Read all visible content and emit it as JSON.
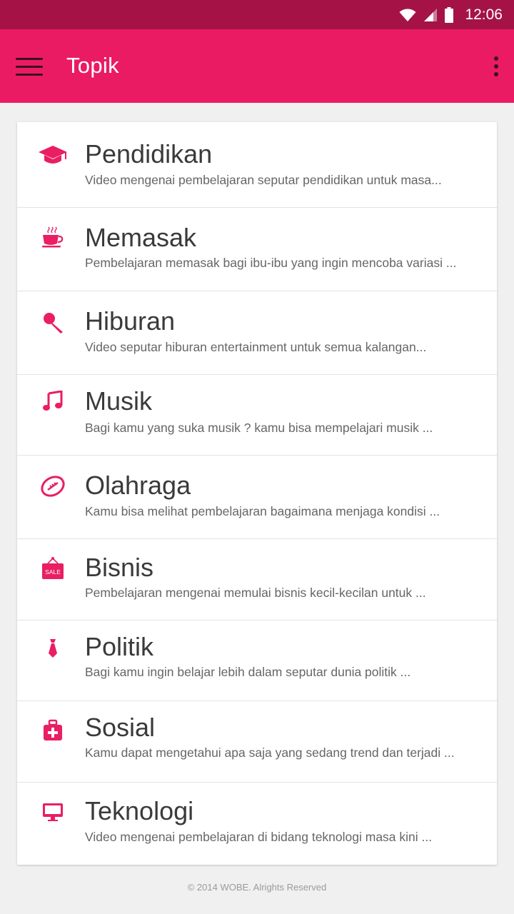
{
  "status": {
    "time": "12:06"
  },
  "appbar": {
    "title": "Topik"
  },
  "topics": [
    {
      "name": "Pendidikan",
      "desc": "Video mengenai pembelajaran seputar pendidikan untuk masa...",
      "icon": "graduation-cap-icon"
    },
    {
      "name": "Memasak",
      "desc": "Pembelajaran memasak bagi ibu-ibu yang ingin mencoba variasi ...",
      "icon": "coffee-cup-icon"
    },
    {
      "name": "Hiburan",
      "desc": "Video seputar hiburan entertainment untuk semua kalangan...",
      "icon": "microphone-icon"
    },
    {
      "name": "Musik",
      "desc": "Bagi kamu yang suka musik ? kamu bisa mempelajari musik ...",
      "icon": "music-note-icon"
    },
    {
      "name": "Olahraga",
      "desc": "Kamu bisa melihat pembelajaran bagaimana menjaga kondisi ...",
      "icon": "football-icon"
    },
    {
      "name": "Bisnis",
      "desc": "Pembelajaran mengenai memulai bisnis kecil-kecilan untuk ...",
      "icon": "sale-sign-icon",
      "icon_text": "SALE"
    },
    {
      "name": "Politik",
      "desc": "Bagi kamu ingin belajar lebih dalam seputar dunia politik ...",
      "icon": "necktie-icon"
    },
    {
      "name": "Sosial",
      "desc": "Kamu dapat mengetahui apa saja yang sedang trend dan terjadi ...",
      "icon": "first-aid-kit-icon"
    },
    {
      "name": "Teknologi",
      "desc": "Video mengenai pembelajaran di bidang teknologi masa kini ...",
      "icon": "monitor-icon"
    }
  ],
  "footer": {
    "text": "© 2014 WOBE. Alrights Reserved"
  },
  "colors": {
    "primary": "#ea1b63",
    "status_bar": "#a51346",
    "accent_icon": "#e91e63"
  }
}
